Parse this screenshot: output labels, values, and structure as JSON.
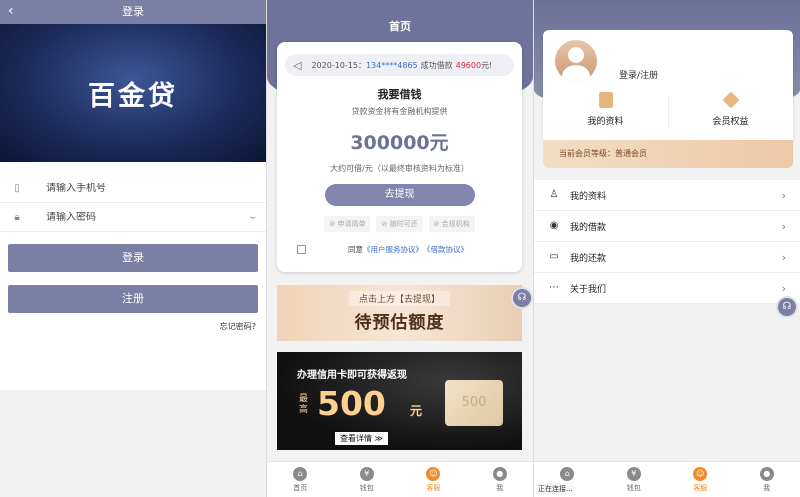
{
  "login": {
    "title": "登录",
    "back": "‹",
    "brand": "百金贷",
    "phone_placeholder": "请输入手机号",
    "password_placeholder": "请输入密码",
    "login_button": "登录",
    "register_button": "注册",
    "forgot": "忘记密码?"
  },
  "home": {
    "title": "首页",
    "notice": {
      "date": "2020-10-15：",
      "phone": "134****4865",
      "text": "成功借款",
      "amount": "49600",
      "suffix": "元!"
    },
    "card_title": "我要借钱",
    "card_subtitle": "贷款资金将有金融机构提供",
    "amount": "300000元",
    "rate": "大约可借/元（以最终审核资料为标准）",
    "withdraw_button": "去提现",
    "features": [
      "申请简单",
      "随时可还",
      "合规机构"
    ],
    "agree_text": "同意",
    "agree_link1": "《用户服务协议》",
    "agree_link2": "《借款协议》",
    "banner1_top": "点击上方【去提现】",
    "banner1_main": "待预估额度",
    "banner2_title": "办理信用卡即可获得返现",
    "banner2_gao": "最高",
    "banner2_num": "500",
    "banner2_unit": "元",
    "banner2_btn": "查看详情 ≫",
    "banner2_card": "500"
  },
  "tabs": [
    {
      "label": "首页"
    },
    {
      "label": "钱包"
    },
    {
      "label": "客服"
    },
    {
      "label": "我"
    }
  ],
  "profile": {
    "login_link": "登录/注册",
    "quick1": "我的资料",
    "quick2": "会员权益",
    "level": "当前会员等级：普通会员",
    "menu": [
      "我的资料",
      "我的借款",
      "我的还款",
      "关于我们"
    ],
    "loading": "正在连接..."
  },
  "colors": {
    "primary": "#7b7fa4",
    "accent": "#f08b2a",
    "link": "#3c6fc6",
    "gold": "#e6b77d"
  }
}
